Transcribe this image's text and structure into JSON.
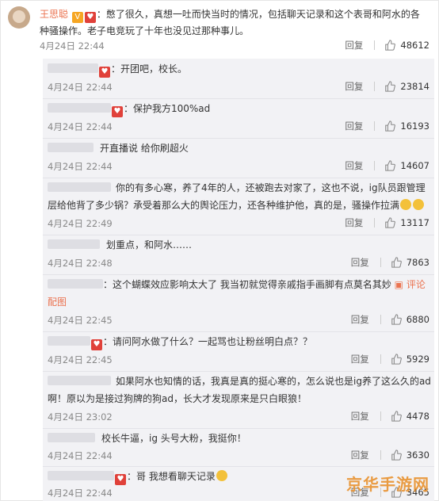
{
  "main": {
    "name": "王思聪",
    "sep": "：",
    "text": "憋了很久，真想一吐而快当时的情况，包括聊天记录和这个表哥和阿水的各种骚操作。老子电竞玩了十年也没见过那种事儿。",
    "time": "4月24日 22:44",
    "reply_label": "回复",
    "likes": "48612"
  },
  "replies": [
    {
      "text": "：开团吧，校长。",
      "time": "4月24日 22:44",
      "reply_label": "回复",
      "likes": "23814"
    },
    {
      "text": "：保护我方100%ad",
      "time": "4月24日 22:44",
      "reply_label": "回复",
      "likes": "16193"
    },
    {
      "text": "开直播说 给你刷超火",
      "time": "4月24日 22:44",
      "reply_label": "回复",
      "likes": "14607"
    },
    {
      "text": "你的有多心寒，养了4年的人，还被跑去对家了，这也不说，ig队员跟管理层给他背了多少锅？承受着那么大的舆论压力，还各种维护他，真的是，骚操作拉满",
      "time": "4月24日 22:49",
      "reply_label": "回复",
      "likes": "13117"
    },
    {
      "text": "划重点，和阿水……",
      "time": "4月24日 22:48",
      "reply_label": "回复",
      "likes": "7863"
    },
    {
      "text": "：这个蝴蝶效应影响太大了 我当初就觉得亲戚指手画脚有点莫名其妙",
      "time": "4月24日 22:45",
      "reply_label": "回复",
      "likes": "6880",
      "link_label": "评论配图"
    },
    {
      "text": "：请问阿水做了什么？一起骂也让粉丝明白点？？",
      "time": "4月24日 22:45",
      "reply_label": "回复",
      "likes": "5929"
    },
    {
      "text": "如果阿水也知情的话，我真是真的挺心寒的，怎么说也是ig养了这么久的ad啊！原以为是接过狗牌的狗ad，长大才发现原来是只白眼狼！",
      "time": "4月24日 23:02",
      "reply_label": "回复",
      "likes": "4478"
    },
    {
      "text": "校长牛逼，ig 头号大粉，我挺你！",
      "time": "4月24日 22:44",
      "reply_label": "回复",
      "likes": "3630"
    },
    {
      "text": "：哥 我想看聊天记录",
      "time": "4月24日 22:44",
      "reply_label": "回复",
      "likes": "3465"
    }
  ],
  "watermark": "京华手游网",
  "colors": {
    "accent": "#eb7350",
    "reply_bg": "#f2f2f5",
    "badge": "#f6a623"
  },
  "icons": {
    "like": "thumbs-up-icon",
    "vip": "vip-badge-icon"
  }
}
